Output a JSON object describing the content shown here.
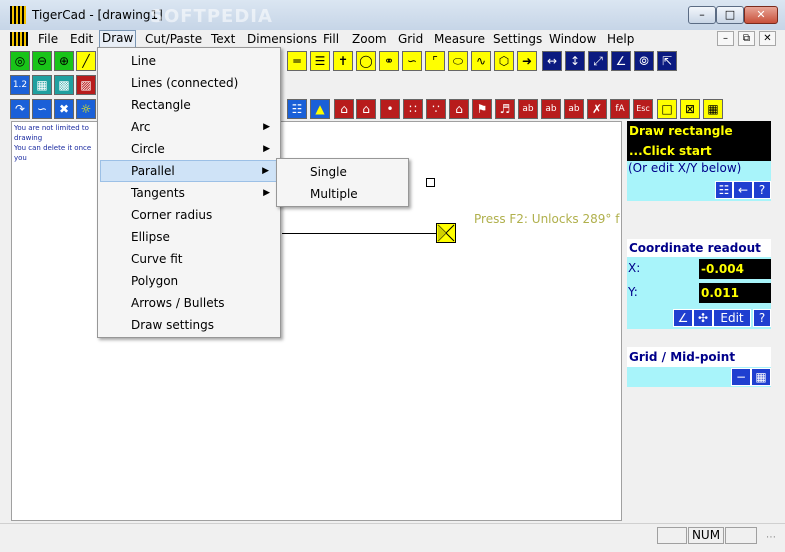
{
  "window": {
    "title": "TigerCad - [drawing1]",
    "watermark": "SOFTPEDIA"
  },
  "menu": [
    "File",
    "Edit",
    "Draw",
    "Cut/Paste",
    "Text",
    "Dimensions",
    "Fill",
    "Zoom",
    "Grid",
    "Measure",
    "Settings",
    "Window",
    "Help"
  ],
  "draw_menu": {
    "items": [
      "Line",
      "Lines (connected)",
      "Rectangle",
      "Arc",
      "Circle",
      "Parallel",
      "Tangents",
      "Corner radius",
      "Ellipse",
      "Curve fit",
      "Polygon",
      "Arrows / Bullets",
      "Draw settings"
    ]
  },
  "parallel_submenu": [
    "Single",
    "Multiple"
  ],
  "toolbar_text": {
    "scale": "1.2",
    "ab1": "ab",
    "ab2": "ab",
    "ab3": "ab",
    "fa": "fA",
    "esc": "Esc"
  },
  "canvas": {
    "hint_line1": "You are not limited to drawing",
    "hint_line2": "You can delete it once you",
    "status_hint": "Press F2: Unlocks 289° f"
  },
  "right_panel": {
    "instruction_line1": "Draw rectangle",
    "instruction_line2": "...Click start",
    "edit_hint": "(Or edit X/Y below)",
    "coord_title": "Coordinate readout",
    "x_label": "X:",
    "x_value": "-0.004",
    "y_label": "Y:",
    "y_value": "0.011",
    "edit_label": "Edit",
    "help_label": "?",
    "grid_title": "Grid / Mid-point"
  },
  "statusbar": {
    "num": "NUM"
  },
  "colors": {
    "tool_yellow": "#ffff00",
    "panel_cyan": "#a8f4fa",
    "panel_dark": "#000000",
    "text_yellow": "#ffff00"
  }
}
